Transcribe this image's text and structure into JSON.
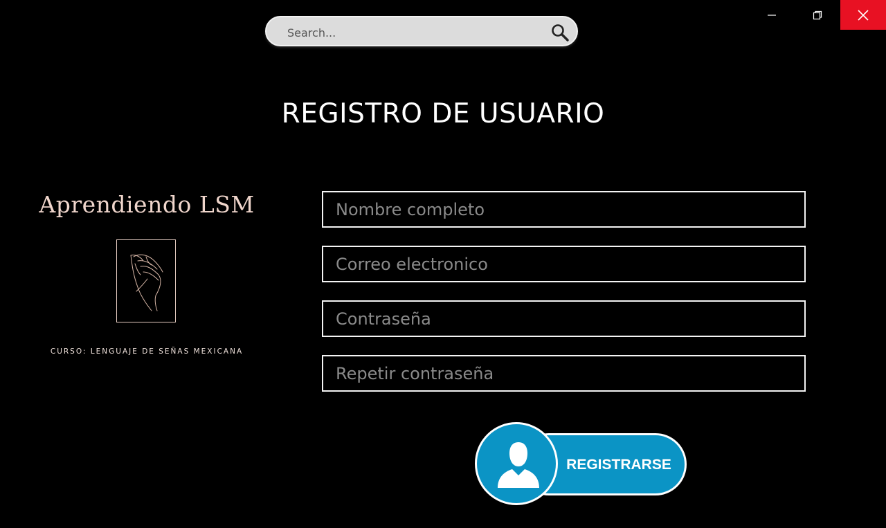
{
  "window": {
    "controls": {
      "minimize_icon": "minimize-icon",
      "restore_icon": "restore-icon",
      "close_icon": "close-icon",
      "close_color": "#e81123"
    }
  },
  "search": {
    "placeholder": "Search...",
    "value": "",
    "icon": "search-icon"
  },
  "page": {
    "title": "REGISTRO DE USUARIO"
  },
  "brand": {
    "name": "Aprendiendo LSM",
    "logo_icon": "hand-sign-icon",
    "caption": "CURSO: LENGUAJE DE SEÑAS MEXICANA",
    "accent_color": "#f0d6cc"
  },
  "form": {
    "fields": [
      {
        "placeholder": "Nombre completo",
        "value": ""
      },
      {
        "placeholder": "Correo electronico",
        "value": ""
      },
      {
        "placeholder": "Contraseña",
        "value": ""
      },
      {
        "placeholder": "Repetir contraseña",
        "value": ""
      }
    ],
    "submit": {
      "label": "REGISTRARSE",
      "icon": "user-icon",
      "color": "#0b94c5"
    }
  }
}
